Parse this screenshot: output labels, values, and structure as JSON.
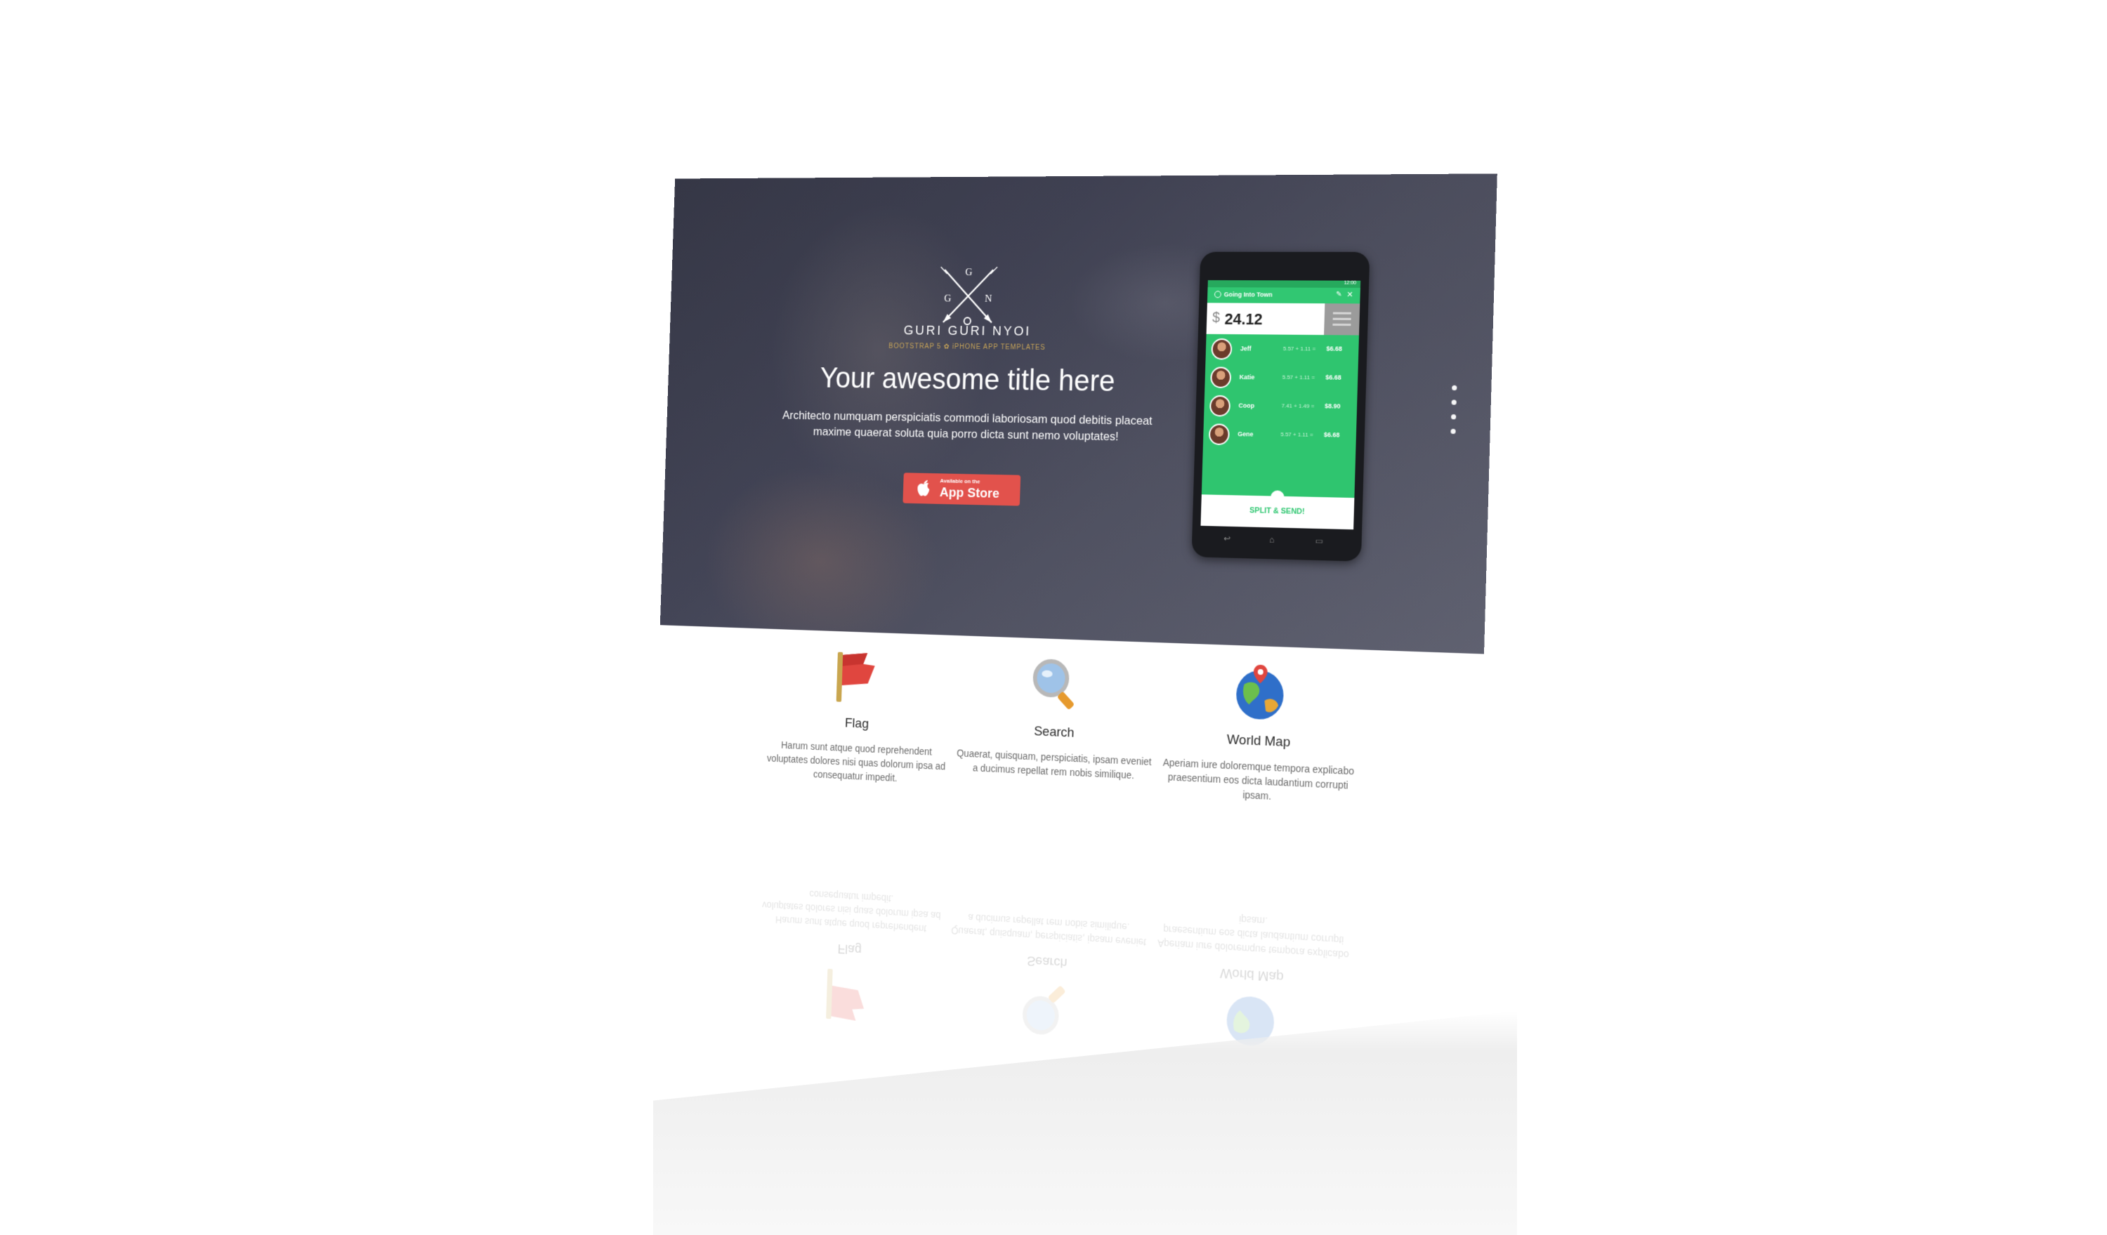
{
  "brand": {
    "monogram": [
      "G",
      "N",
      "G"
    ],
    "name": "GURI GURI NYOI",
    "tagline": "BOOTSTRAP 5 ✿ iPHONE APP TEMPLATES"
  },
  "hero": {
    "title": "Your awesome title here",
    "text": "Architecto numquam perspiciatis commodi laboriosam quod debitis placeat maxime quaerat soluta quia porro dicta sunt nemo voluptates!",
    "appstore_small": "Available on the",
    "appstore_big": "App Store",
    "slide_count": 4
  },
  "phone": {
    "status_time": "12:00",
    "app_title": "Going Into Town",
    "currency": "$",
    "amount": "24.12",
    "people": [
      {
        "name": "Jeff",
        "calc": "5.57 + 1.11 =",
        "total": "$6.68"
      },
      {
        "name": "Katie",
        "calc": "5.57 + 1.11 =",
        "total": "$6.68"
      },
      {
        "name": "Coop",
        "calc": "7.41 + 1.49 =",
        "total": "$8.90"
      },
      {
        "name": "Gene",
        "calc": "5.57 + 1.11 =",
        "total": "$6.68"
      }
    ],
    "split_label": "SPLIT & SEND!"
  },
  "features": [
    {
      "title": "Flag",
      "icon": "flag-icon",
      "text": "Harum sunt atque quod reprehendent voluptates dolores nisi quas dolorum ipsa ad consequatur impedit."
    },
    {
      "title": "Search",
      "icon": "search-icon",
      "text": "Quaerat, quisquam, perspiciatis, ipsam eveniet a ducimus repellat rem nobis similique."
    },
    {
      "title": "World Map",
      "icon": "world-map-icon",
      "text": "Aperiam iure doloremque tempora explicabo praesentium eos dicta laudantium corrupti ipsam."
    }
  ],
  "colors": {
    "accent_gold": "#c7a458",
    "appstore_red": "#e2524c",
    "app_green": "#2fc56f"
  }
}
